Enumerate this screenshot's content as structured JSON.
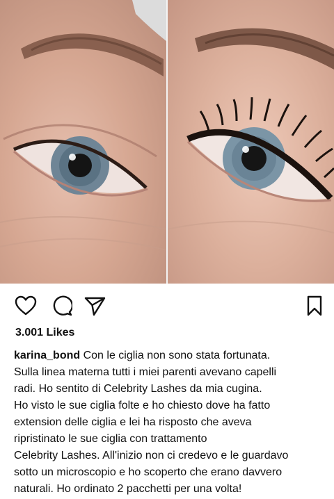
{
  "post": {
    "likes_label": "3.001 Likes",
    "username": "karina_bond",
    "caption_first": "Con le ciglia non sono stata fortunata.",
    "caption_lines": [
      "Sulla linea materna tutti i miei parenti avevano capelli",
      "radi. Ho sentito di Celebrity Lashes da mia cugina.",
      "Ho visto le sue ciglia folte e ho chiesto dove ha fatto",
      "extension delle ciglia e lei ha risposto che aveva",
      "ripristinato le sue  ciglia con trattamento",
      "Celebrity Lashes. All'inizio non ci credevo e le guardavo",
      "sotto un microscopio e ho  scoperto che erano davvero",
      "naturali. Ho ordinato 2 pacchetti per una volta!"
    ]
  },
  "actions": {
    "like": "heart-icon",
    "comment": "comment-icon",
    "share": "send-icon",
    "save": "bookmark-icon"
  }
}
